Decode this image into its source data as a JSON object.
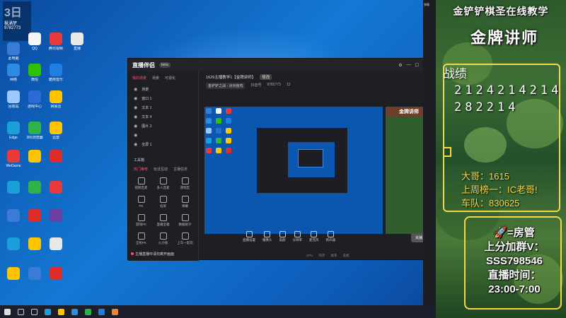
{
  "desktop": {
    "id_box": {
      "big": "3日",
      "name": "枫涌梦",
      "number": "9782773"
    },
    "icons": [
      {
        "label": "此电脑",
        "color": "#3a7bd5"
      },
      {
        "label": "QQ",
        "color": "#f5f5f5"
      },
      {
        "label": "腾讯视频",
        "color": "#e8e8e8"
      },
      {
        "label": "直播",
        "color": "#6a3fa0"
      },
      {
        "label": "网络",
        "color": "#2d8ce0"
      },
      {
        "label": "微信",
        "color": "#2dc100"
      },
      {
        "label": "酷狗音乐",
        "color": "#1f7fe0"
      },
      {
        "label": "回收站",
        "color": "#9bc9ff"
      },
      {
        "label": "游戏中心",
        "color": "#2b6bd8"
      },
      {
        "label": "网易云",
        "color": "#e02b2b"
      },
      {
        "label": "Edge",
        "color": "#1a9fd8"
      },
      {
        "label": "360浏览器",
        "color": "#2db34a"
      },
      {
        "label": "迅雷",
        "color": "#ffc400"
      },
      {
        "label": "WeGame",
        "color": "#e83a3a"
      }
    ]
  },
  "app": {
    "logo": "直播伴侣",
    "version": "beta",
    "left_tabs": [
      "我的场景",
      "场景",
      "可视化"
    ],
    "sources": [
      "场景",
      "窗口 1",
      "文本 1",
      "文本 4",
      "图片 3",
      "",
      "全屏 1"
    ],
    "tools_header": "工具箱",
    "tools_tabs": [
      "热门推荐",
      "玩法互动",
      "主播任务"
    ],
    "tools": [
      "视频连麦",
      "多人连麦",
      "游戏区",
      "PK",
      "投屏",
      "弹幕",
      "游戏PK",
      "直播宝箱",
      "数据统计",
      "全民PK",
      "火力值",
      "上车一起玩"
    ],
    "status": "主播直播中请勿离开画面",
    "room_title": "1629主播教学1【金牌讲师】",
    "room_btn": "修改",
    "sub_pill": "金铲铲之战 - 对对宫鸡",
    "sub_user": "抖音号",
    "sub_id": "9782773",
    "sub_count": "12",
    "panel_title": "金牌讲师",
    "bottom_buttons": [
      "直播设置",
      "摄像头",
      "美颜",
      "分辨率",
      "麦克风",
      "扬声器"
    ],
    "start_label": "关播",
    "stats": [
      "CPU",
      "内存",
      "帧率",
      "丢帧"
    ]
  },
  "overlay": {
    "top_text": "金铲铲棋圣在线教学",
    "badge": "金牌讲师",
    "record_label": "战绩",
    "record_line1": "2124214214",
    "record_line2": "282214",
    "info": [
      "大哥：1615",
      "上周榜一：IC老哥!",
      "车队：830625"
    ],
    "manager": [
      "🚀=房管",
      "上分加群V：",
      "SSS798546",
      "直播时间：",
      "23:00-7:00"
    ]
  },
  "midbar": {
    "label": "弹幕"
  }
}
